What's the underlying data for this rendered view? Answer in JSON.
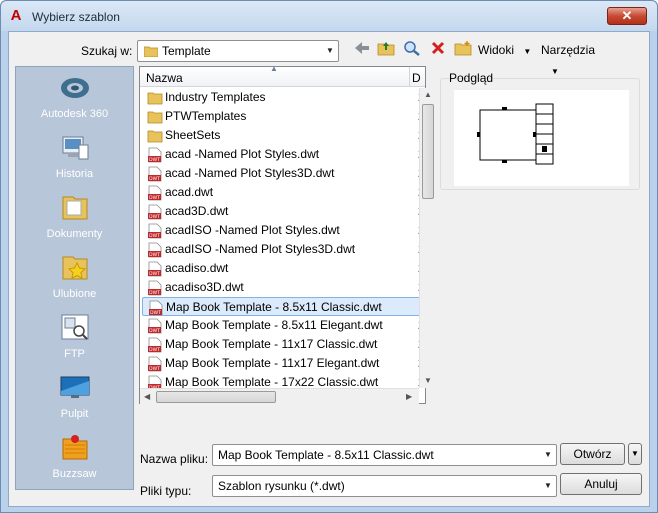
{
  "window": {
    "title": "Wybierz szablon",
    "close_glyph": "✕"
  },
  "toolbar": {
    "lookin_label": "Szukaj w:",
    "lookin_value": "Template",
    "views_label": "Widoki",
    "tools_label": "Narzędzia"
  },
  "places": [
    {
      "label": "Autodesk 360",
      "icon": "cloud-icon"
    },
    {
      "label": "Historia",
      "icon": "history-icon"
    },
    {
      "label": "Dokumenty",
      "icon": "documents-folder-icon"
    },
    {
      "label": "Ulubione",
      "icon": "favorites-folder-icon"
    },
    {
      "label": "FTP",
      "icon": "ftp-icon"
    },
    {
      "label": "Pulpit",
      "icon": "desktop-icon"
    },
    {
      "label": "Buzzsaw",
      "icon": "buzzsaw-icon"
    }
  ],
  "filelist": {
    "column_name": "Nazwa",
    "column_second": "D",
    "rows": [
      {
        "name": "Industry Templates",
        "type": "folder",
        "date": ""
      },
      {
        "name": "PTWTemplates",
        "type": "folder",
        "date": ""
      },
      {
        "name": "SheetSets",
        "type": "folder",
        "date": ""
      },
      {
        "name": "acad -Named Plot Styles.dwt",
        "type": "dwt",
        "date": "2"
      },
      {
        "name": "acad -Named Plot Styles3D.dwt",
        "type": "dwt",
        "date": "2"
      },
      {
        "name": "acad.dwt",
        "type": "dwt",
        "date": "2"
      },
      {
        "name": "acad3D.dwt",
        "type": "dwt",
        "date": "2"
      },
      {
        "name": "acadISO -Named Plot Styles.dwt",
        "type": "dwt",
        "date": "2"
      },
      {
        "name": "acadISO -Named Plot Styles3D.dwt",
        "type": "dwt",
        "date": "2"
      },
      {
        "name": "acadiso.dwt",
        "type": "dwt",
        "date": "2"
      },
      {
        "name": "acadiso3D.dwt",
        "type": "dwt",
        "date": "2"
      },
      {
        "name": "Map Book Template - 8.5x11 Classic.dwt",
        "type": "dwt",
        "date": "2",
        "selected": true
      },
      {
        "name": "Map Book Template - 8.5x11 Elegant.dwt",
        "type": "dwt",
        "date": "2"
      },
      {
        "name": "Map Book Template - 11x17 Classic.dwt",
        "type": "dwt",
        "date": "2"
      },
      {
        "name": "Map Book Template - 11x17 Elegant.dwt",
        "type": "dwt",
        "date": "2"
      },
      {
        "name": "Map Book Template - 17x22 Classic.dwt",
        "type": "dwt",
        "date": "2"
      }
    ],
    "folder_dates": [
      "2",
      "2",
      "2"
    ]
  },
  "preview": {
    "label": "Podgląd"
  },
  "form": {
    "filename_label": "Nazwa pliku:",
    "filename_value": "Map Book Template - 8.5x11 Classic.dwt",
    "filetype_label": "Pliki typu:",
    "filetype_value": "Szablon rysunku (*.dwt)",
    "open_label": "Otwórz",
    "cancel_label": "Anuluj"
  },
  "colors": {
    "places_bg": "#b7c6d8",
    "selection": "#dcebfc",
    "title_accent": "#c40000"
  }
}
